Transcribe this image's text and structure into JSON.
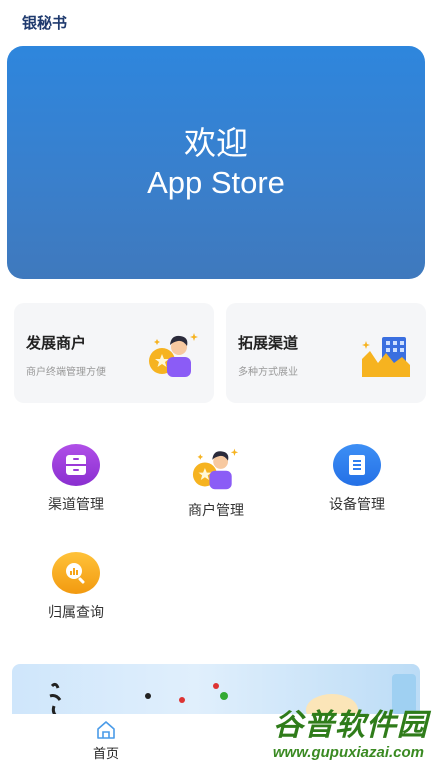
{
  "app": {
    "title": "银秘书"
  },
  "hero": {
    "line1": "欢迎",
    "line2": "App Store"
  },
  "cards": [
    {
      "title": "发展商户",
      "subtitle": "商户终端管理方便",
      "icon": "merchant-person-icon"
    },
    {
      "title": "拓展渠道",
      "subtitle": "多种方式展业",
      "icon": "channel-building-icon"
    }
  ],
  "grid": [
    {
      "label": "渠道管理",
      "icon": "drawer-icon",
      "color": "#9b3ad8"
    },
    {
      "label": "商户管理",
      "icon": "merchant-person-icon",
      "color": "#f4a623"
    },
    {
      "label": "设备管理",
      "icon": "document-icon",
      "color": "#2f7ff0"
    },
    {
      "label": "归属查询",
      "icon": "search-chart-icon",
      "color": "#f6a51a"
    }
  ],
  "tabbar": {
    "home_label": "首页"
  },
  "watermark": {
    "cn": "谷普软件园",
    "url": "www.gupuxiazai.com"
  }
}
